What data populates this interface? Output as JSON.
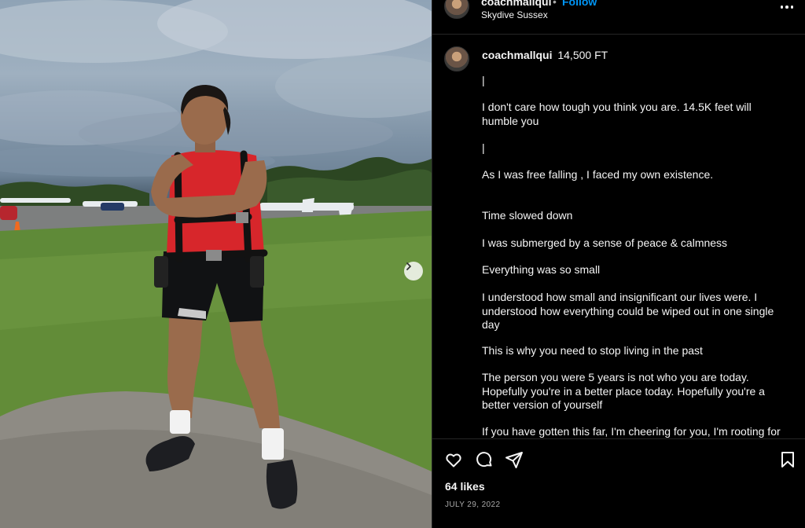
{
  "post": {
    "username": "coachmallqui",
    "follow_label": "Follow",
    "dot": "•",
    "location": "Skydive Sussex",
    "more_icon": "more-horizontal-icon"
  },
  "caption": {
    "username": "coachmallqui",
    "headline": "14,500 FT",
    "lines": [
      "|",
      "I don't care how tough you think you are. 14.5K feet will humble you",
      "|",
      "As I was free falling , I faced my own existence.",
      "Time slowed down",
      "I was submerged by a sense of peace & calmness",
      "Everything was so small",
      "I understood how small and insignificant our lives were. I understood how everything could be wiped out in one single day",
      "This is why you need to stop living in the past",
      "The person you were 5 years is not who you are today. Hopefully you're in a better place today. Hopefully you're a better version of yourself",
      "If you have gotten this far, I'm cheering for you, I'm rooting for"
    ]
  },
  "actions": {
    "icons": [
      "heart-icon",
      "comment-icon",
      "share-icon",
      "bookmark-icon"
    ],
    "likes": "64 likes",
    "date": "JULY 29, 2022"
  },
  "media": {
    "next_icon": "chevron-right-icon"
  },
  "colors": {
    "link": "#0095f6",
    "background": "#000000",
    "text": "#f5f5f5",
    "muted": "#a8a8a8"
  }
}
